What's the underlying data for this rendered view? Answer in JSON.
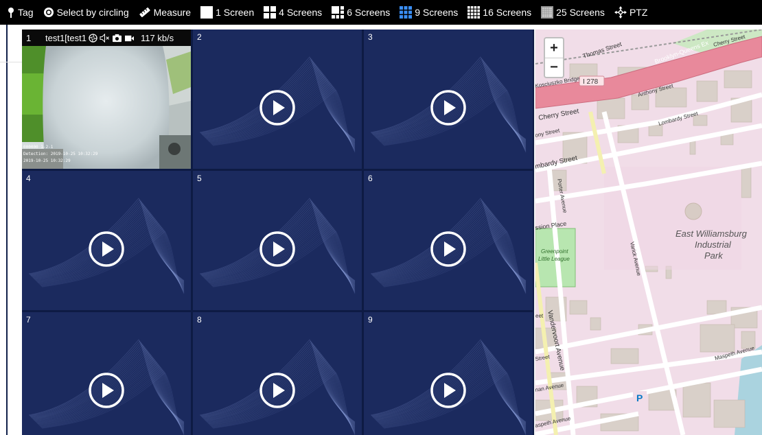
{
  "toolbar": {
    "items": [
      {
        "label": "Tag",
        "icon": "pin-icon"
      },
      {
        "label": "Select by circling",
        "icon": "circle-select-icon"
      },
      {
        "label": "Measure",
        "icon": "ruler-icon"
      },
      {
        "label": "1 Screen",
        "icon": "layout-1-icon"
      },
      {
        "label": "4 Screens",
        "icon": "layout-4-icon"
      },
      {
        "label": "6 Screens",
        "icon": "layout-6-icon"
      },
      {
        "label": "9 Screens",
        "icon": "layout-9-icon"
      },
      {
        "label": "16 Screens",
        "icon": "layout-16-icon"
      },
      {
        "label": "25 Screens",
        "icon": "layout-25-icon"
      },
      {
        "label": "PTZ",
        "icon": "ptz-icon"
      }
    ]
  },
  "grid": {
    "active_cell": {
      "number": "1",
      "title": "test1[test1",
      "bitrate": "117 kb/s",
      "overlay_lines": [
        "000000 1-2-1",
        "Detection: 2019-10-25 10:32:29",
        "2019-10-25 10:32:29"
      ]
    },
    "cells": [
      "2",
      "3",
      "4",
      "5",
      "6",
      "7",
      "8",
      "9"
    ]
  },
  "map": {
    "zoom_in": "+",
    "zoom_out": "−",
    "labels": {
      "thomas_street": "Thomas Street",
      "bqe": "Brooklyn-Queens Ex",
      "cherry_street_top": "Cherry Street",
      "i278": "I 278",
      "bridge": "Kosciuszko Bridge",
      "anthony_street": "Anthony Street",
      "cherry_street": "Cherry Street",
      "lombardy_street_right": "Lombardy Street",
      "any_street": "ony Street",
      "lombardy_street_left": "mbardy Street",
      "porter_avenue": "Porter Avenue",
      "mission_place": "ssion Place",
      "park1": "Greenpoint",
      "park2": "Little League",
      "varick_avenue": "Varick Avenue",
      "ewi1": "East Williamsburg",
      "ewi2": "Industrial",
      "ewi3": "Park",
      "vandervoort": "Vandervoort Avenue",
      "eet": "eet",
      "street": "Street",
      "maspeth_right": "Maspeth Avenue",
      "nan_avenue": "nan Avenue",
      "maspeth_left": "aspeth Avenue",
      "parking": "P"
    }
  },
  "colors": {
    "toolbar_bg": "#000000",
    "grid_bg": "#0e1b44",
    "cell_bg": "#1b2a5e",
    "layout_active": "#3a8ef5",
    "map_bg": "#f1dde8",
    "highway": "#e8899b",
    "park": "#b8e6b0"
  }
}
